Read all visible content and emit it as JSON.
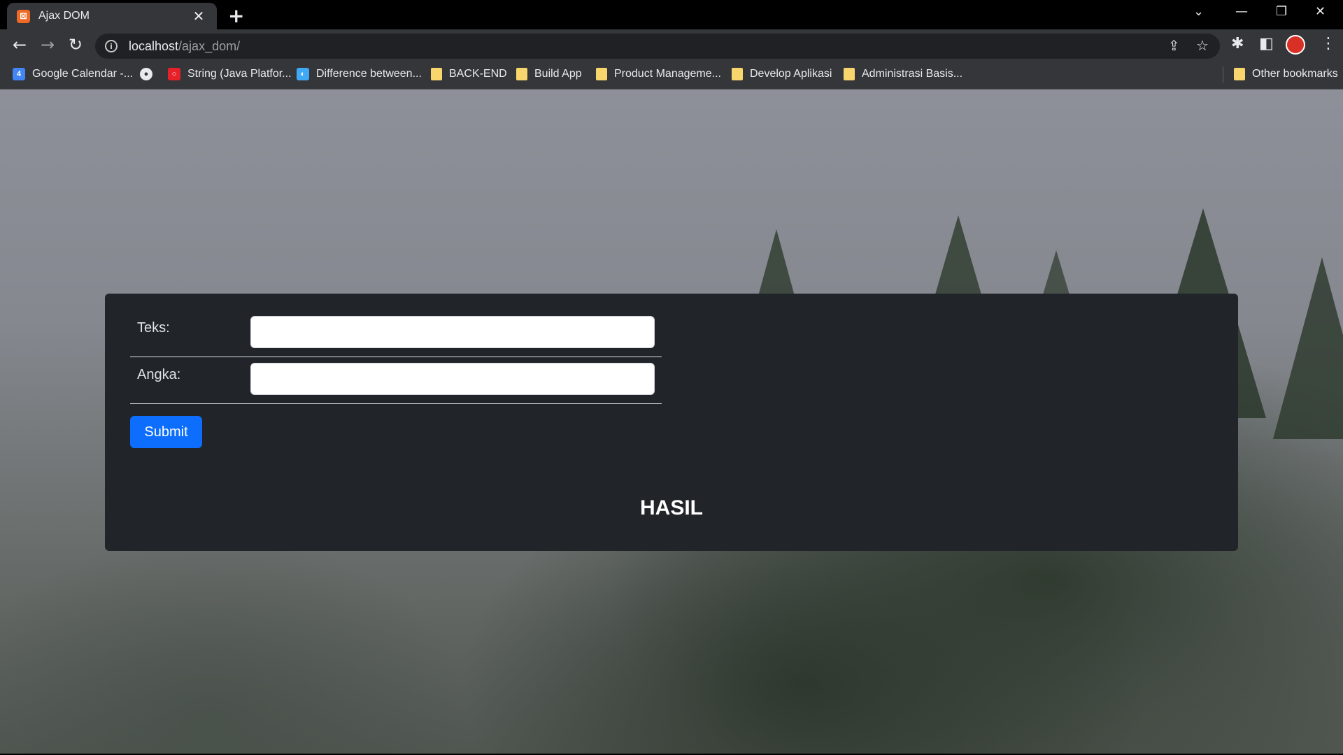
{
  "browser": {
    "tab": {
      "title": "Ajax DOM",
      "favicon_icon": "xampp-icon"
    },
    "address": {
      "host": "localhost",
      "path": "/ajax_dom/"
    },
    "bookmarks": [
      {
        "label": "Google Calendar -...",
        "icon": "calendar-icon"
      },
      {
        "label": "",
        "icon": "globe-icon"
      },
      {
        "label": "String (Java Platfor...",
        "icon": "oracle-icon"
      },
      {
        "label": "Difference between...",
        "icon": "site-icon"
      },
      {
        "label": "BACK-END",
        "icon": "folder-icon"
      },
      {
        "label": "Build App",
        "icon": "folder-icon"
      },
      {
        "label": "Product Manageme...",
        "icon": "folder-icon"
      },
      {
        "label": "Develop Aplikasi",
        "icon": "folder-icon"
      },
      {
        "label": "Administrasi Basis...",
        "icon": "folder-icon"
      }
    ],
    "other_bookmarks": "Other bookmarks"
  },
  "form": {
    "teks_label": "Teks:",
    "teks_value": "",
    "angka_label": "Angka:",
    "angka_value": "",
    "submit_label": "Submit"
  },
  "result": {
    "heading": "HASIL"
  },
  "colors": {
    "panel": "#212529",
    "button": "#0d6efd",
    "tab_favicon": "#f06925"
  }
}
